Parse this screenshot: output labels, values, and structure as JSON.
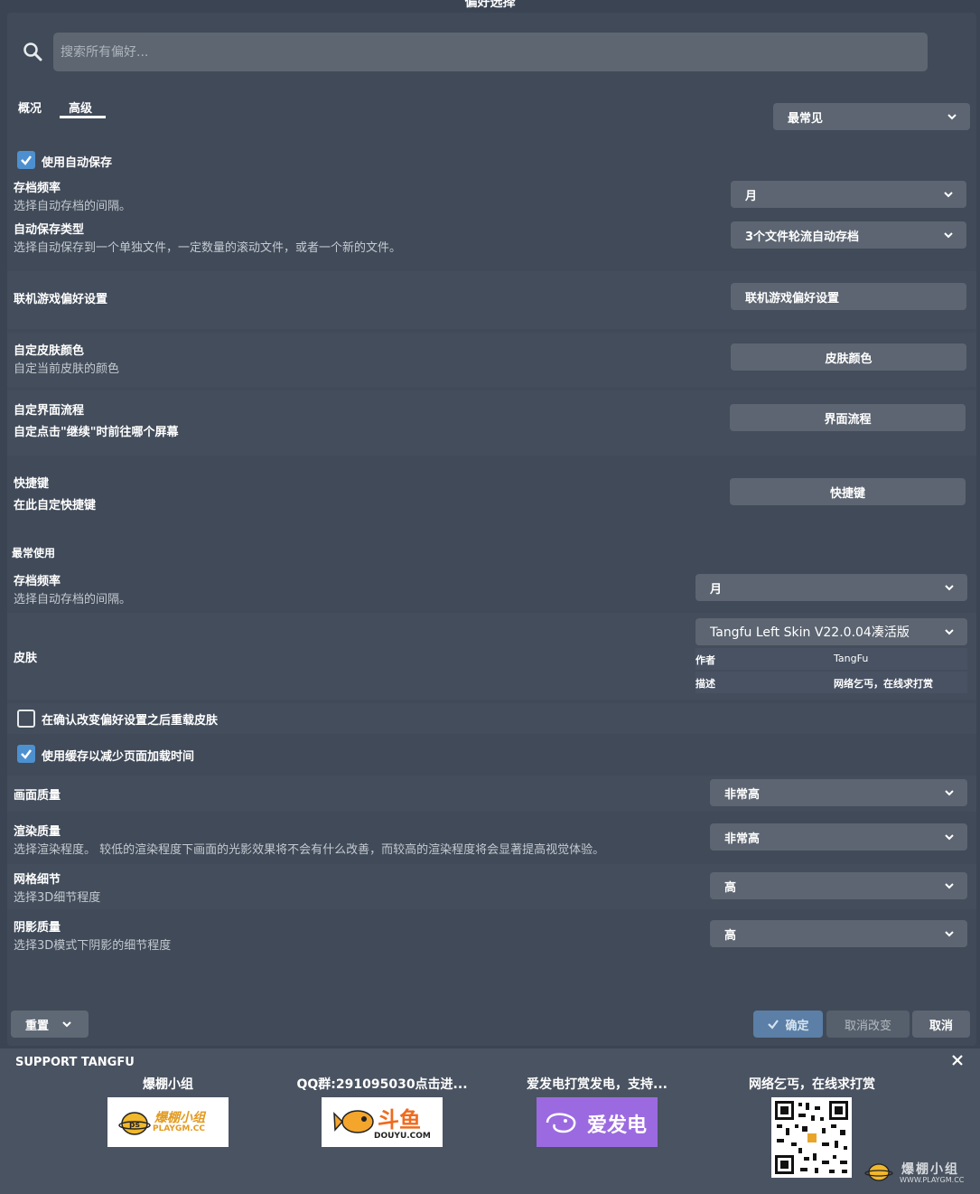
{
  "window": {
    "title": "偏好选择"
  },
  "search": {
    "placeholder": "搜索所有偏好..."
  },
  "tabs": [
    {
      "label": "概况"
    },
    {
      "label": "高级"
    }
  ],
  "filter": {
    "value": "最常见"
  },
  "autosave": {
    "checkbox_label": "使用自动保存",
    "frequency": {
      "label": "存档频率",
      "desc": "选择自动存档的间隔。",
      "value": "月"
    },
    "type": {
      "label": "自动保存类型",
      "desc": "选择自动保存到一个单独文件，一定数量的滚动文件，或者一个新的文件。",
      "value": "3个文件轮流自动存档"
    }
  },
  "online": {
    "label": "联机游戏偏好设置",
    "button": "联机游戏偏好设置"
  },
  "skin_color": {
    "label": "自定皮肤颜色",
    "desc": "自定当前皮肤的颜色",
    "button": "皮肤颜色"
  },
  "flow": {
    "label": "自定界面流程",
    "desc": "自定点击\"继续\"时前往哪个屏幕",
    "button": "界面流程"
  },
  "hotkeys": {
    "label": "快捷键",
    "desc": "在此自定快捷键",
    "button": "快捷键"
  },
  "most_used": {
    "header": "最常使用",
    "frequency": {
      "label": "存档频率",
      "desc": "选择自动存档的间隔。",
      "value": "月"
    },
    "skin": {
      "label": "皮肤",
      "value": "Tangfu Left Skin V22.0.04凑活版",
      "author_label": "作者",
      "author": "TangFu",
      "desc_label": "描述",
      "desc": "网络乞丐，在线求打赏"
    }
  },
  "reload_skin": {
    "label": "在确认改变偏好设置之后重载皮肤",
    "checked": false
  },
  "use_cache": {
    "label": "使用缓存以减少页面加载时间",
    "checked": true
  },
  "graphics": {
    "quality": {
      "label": "画面质量",
      "value": "非常高"
    },
    "render": {
      "label": "渲染质量",
      "desc": "选择渲染程度。 较低的渲染程度下画面的光影效果将不会有什么改善，而较高的渲染程度将会显著提高视觉体验。",
      "value": "非常高"
    },
    "mesh": {
      "label": "网格细节",
      "desc": "选择3D细节程度",
      "value": "高"
    },
    "shadow": {
      "label": "阴影质量",
      "desc": "选择3D模式下阴影的细节程度",
      "value": "高"
    }
  },
  "footer": {
    "reset": "重置",
    "ok": "确定",
    "undo": "取消改变",
    "cancel": "取消"
  },
  "support": {
    "title": "SUPPORT TANGFU",
    "items": [
      {
        "caption": "爆棚小组",
        "logo_text": "爆棚小组",
        "logo_sub": "PLAYGM.CC"
      },
      {
        "caption": "QQ群:291095030点击进...",
        "logo_text": "斗鱼",
        "logo_sub": "DOUYU.COM"
      },
      {
        "caption": "爱发电打赏发电，支持...",
        "logo_text": "爱发电"
      },
      {
        "caption": "网络乞丐，在线求打赏"
      }
    ],
    "watermark": "爆棚小组",
    "watermark_sub": "WWW.PLAYGM.CC"
  },
  "colors": {
    "accent": "#4d90d0",
    "panel": "#404a58",
    "control": "#5c6571"
  }
}
